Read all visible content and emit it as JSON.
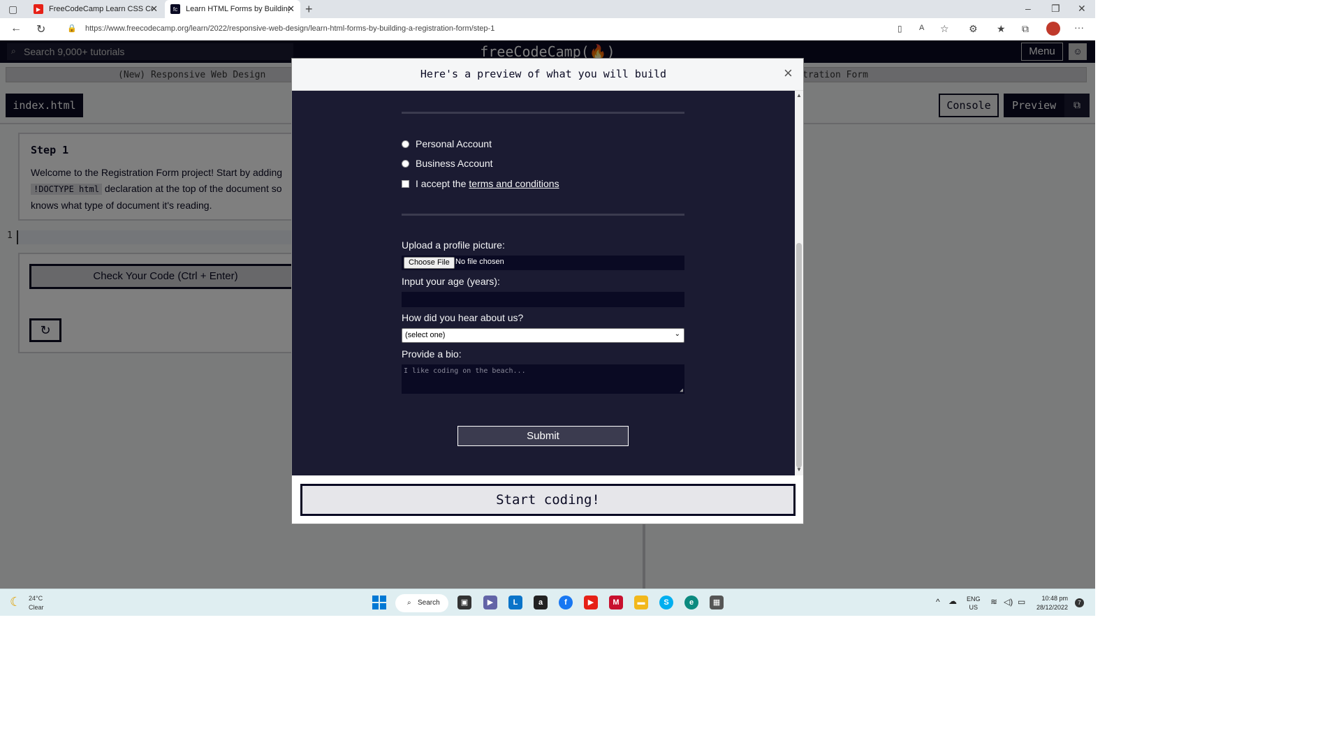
{
  "browser": {
    "tabs": [
      {
        "title": "FreeCodeCamp Learn CSS Colors",
        "active": false
      },
      {
        "title": "Learn HTML Forms by Building a",
        "active": true
      }
    ],
    "url": "https://www.freecodecamp.org/learn/2022/responsive-web-design/learn-html-forms-by-building-a-registration-form/step-1"
  },
  "navbar": {
    "search_placeholder": "Search 9,000+ tutorials",
    "brand": "freeCodeCamp(🔥)",
    "menu_label": "Menu"
  },
  "breadcrumb": {
    "left": "(New) Responsive Web Design",
    "right": "tration Form"
  },
  "editor": {
    "file_tab": "index.html",
    "console_label": "Console",
    "preview_label": "Preview",
    "line_number": "1"
  },
  "step": {
    "title": "Step 1",
    "text_1": "Welcome to the Registration Form project! Start by adding",
    "code": "!DOCTYPE html",
    "text_2": "declaration at the top of the document so",
    "text_3": "knows what type of document it's reading.",
    "check_button": "Check Your Code (Ctrl + Enter)"
  },
  "modal": {
    "title": "Here's a preview of what you will build",
    "radio_personal": "Personal Account",
    "radio_business": "Business Account",
    "terms_prefix": "I accept the",
    "terms_link": "terms and conditions",
    "upload_label": "Upload a profile picture:",
    "choose_file": "Choose File",
    "no_file": "No file chosen",
    "age_label": "Input your age (years):",
    "hear_label": "How did you hear about us?",
    "select_value": "(select one)",
    "bio_label": "Provide a bio:",
    "bio_placeholder": "I like coding on the beach...",
    "submit": "Submit",
    "start_coding": "Start coding!"
  },
  "taskbar": {
    "temp": "24°C",
    "weather": "Clear",
    "search": "Search",
    "lang_1": "ENG",
    "lang_2": "US",
    "time": "10:48 pm",
    "date": "28/12/2022",
    "notif_count": "7"
  }
}
